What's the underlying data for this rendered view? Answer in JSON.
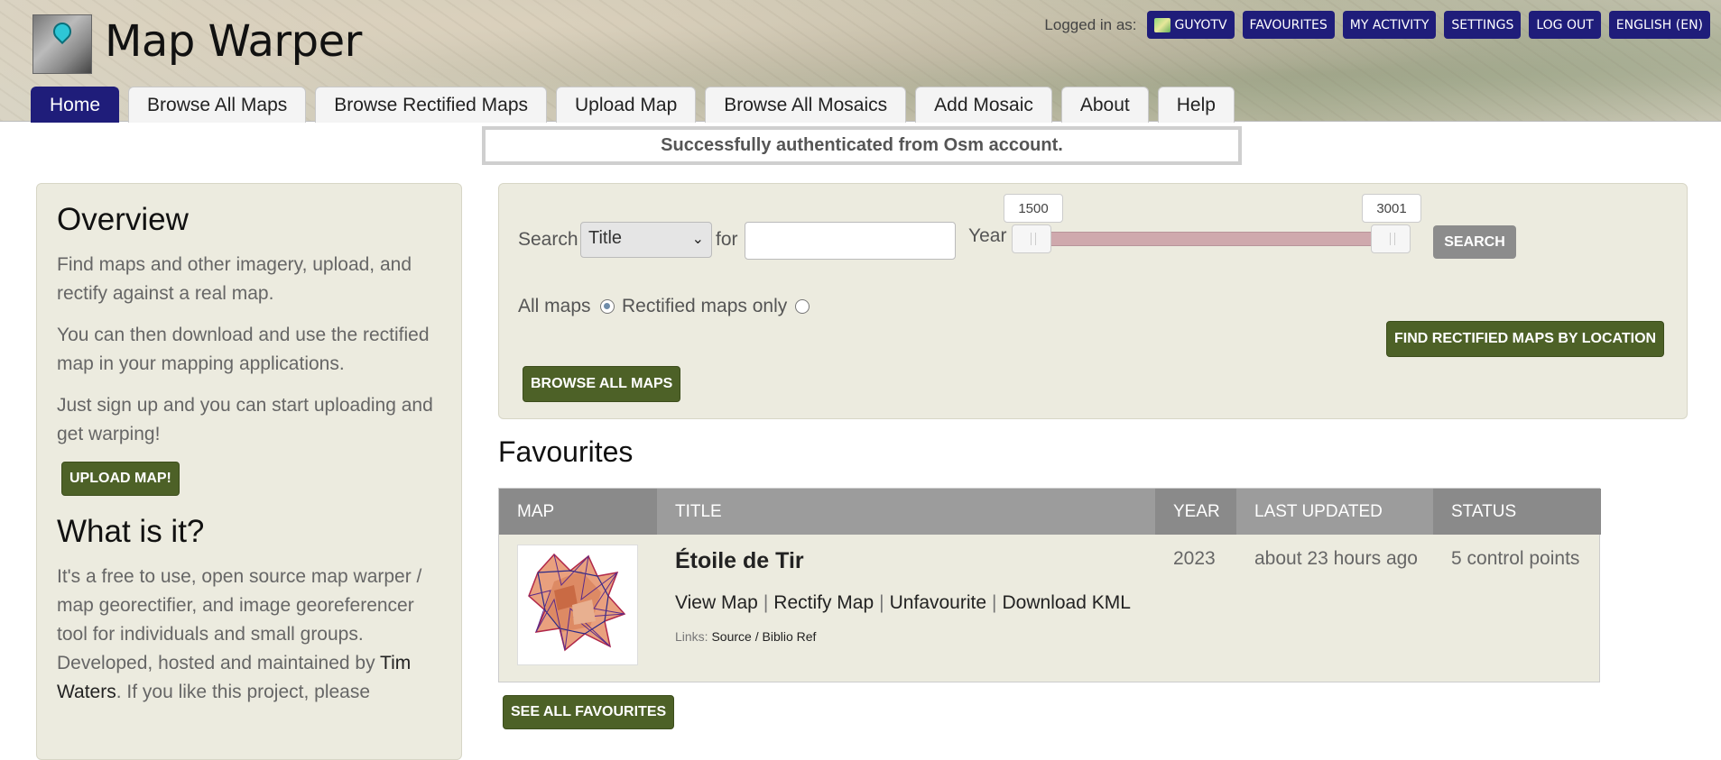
{
  "header": {
    "site_title": "Map Warper",
    "logged_in_label": "Logged in as:",
    "user_buttons": [
      "GUYOTV",
      "FAVOURITES",
      "MY ACTIVITY",
      "SETTINGS",
      "LOG OUT",
      "ENGLISH (EN)"
    ],
    "nav_tabs": [
      "Home",
      "Browse All Maps",
      "Browse Rectified Maps",
      "Upload Map",
      "Browse All Mosaics",
      "Add Mosaic",
      "About",
      "Help"
    ],
    "active_tab": "Home"
  },
  "flash": "Successfully authenticated from Osm account.",
  "sidebar": {
    "overview_title": "Overview",
    "p1": "Find maps and other imagery, upload, and rectify against a real map.",
    "p2": "You can then download and use the rectified map in your mapping applications.",
    "p3": "Just sign up and you can start uploading and get warping!",
    "upload_button": "UPLOAD MAP!",
    "what_title": "What is it?",
    "p4_a": "It's a free to use, open source map warper / map georectifier, and image georeferencer tool for individuals and small groups. Developed, hosted and maintained by ",
    "p4_name": "Tim Waters",
    "p4_b": ". If you like this project, please"
  },
  "search": {
    "search_label": "Search",
    "select_value": "Title",
    "for_label": "for",
    "for_value": "",
    "year_label": "Year",
    "year_min": "1500",
    "year_max": "3001",
    "search_button": "SEARCH",
    "all_maps_label": "All maps",
    "rectified_only_label": "Rectified maps only",
    "find_by_location_button": "FIND RECTIFIED MAPS BY LOCATION",
    "browse_all_button": "BROWSE ALL MAPS"
  },
  "favourites": {
    "title": "Favourites",
    "columns": [
      "MAP",
      "TITLE",
      "YEAR",
      "LAST UPDATED",
      "STATUS"
    ],
    "rows": [
      {
        "title": "Étoile de Tir",
        "links": [
          "View Map",
          "Rectify Map",
          "Unfavourite",
          "Download KML"
        ],
        "ext_links_label": "Links:",
        "ext_links": "Source / Biblio Ref",
        "year": "2023",
        "last_updated": "about 23 hours ago",
        "status": "5 control points"
      }
    ],
    "see_all_button": "SEE ALL FAVOURITES"
  }
}
